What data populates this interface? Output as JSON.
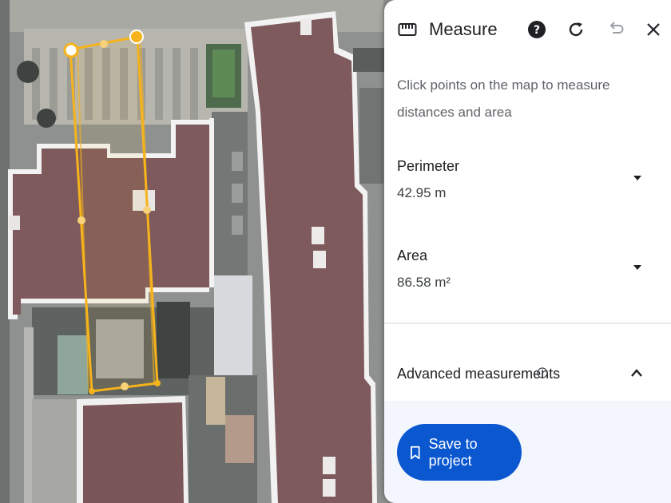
{
  "panel": {
    "title": "Measure",
    "icons": {
      "tool": "ruler-icon",
      "help": "help-icon",
      "refresh": "refresh-icon",
      "undo": "undo-icon",
      "close": "close-icon"
    },
    "description": "Click points on the map to measure distances and area",
    "perimeter": {
      "label": "Perimeter",
      "value": "42.95 m"
    },
    "area": {
      "label": "Area",
      "value": "86.58 m²"
    },
    "advanced": {
      "label": "Advanced measurements"
    },
    "save_button": {
      "label": "Save to project",
      "icon": "bookmark-icon"
    }
  },
  "colors": {
    "accent": "#0b57d0",
    "measure_line": "#f6b31c",
    "roof": "#7e5a5d",
    "panel_bg": "#ffffff",
    "footer_bg": "#f3f6fc"
  }
}
